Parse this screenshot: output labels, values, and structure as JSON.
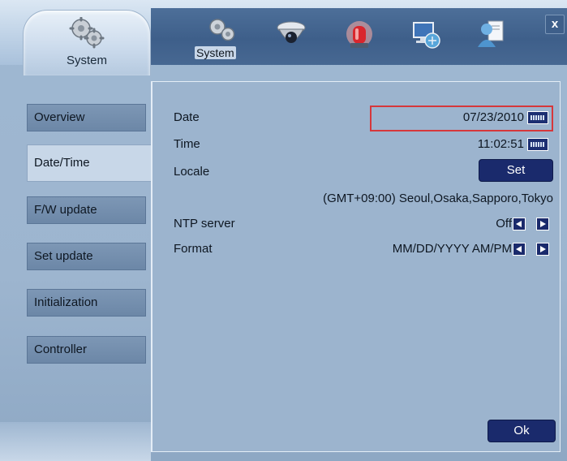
{
  "header": {
    "active_tab_label": "System",
    "icon_row_label": "System",
    "close_label": "x",
    "top_icons": [
      "gear-icon",
      "camera-icon",
      "alarm-icon",
      "network-icon",
      "user-icon"
    ]
  },
  "sidebar": {
    "items": [
      {
        "label": "Overview",
        "active": false
      },
      {
        "label": "Date/Time",
        "active": true
      },
      {
        "label": "F/W update",
        "active": false
      },
      {
        "label": "Set update",
        "active": false
      },
      {
        "label": "Initialization",
        "active": false
      },
      {
        "label": "Controller",
        "active": false
      }
    ]
  },
  "form": {
    "date_label": "Date",
    "date_value": "07/23/2010",
    "time_label": "Time",
    "time_value": "11:02:51",
    "locale_label": "Locale",
    "locale_button": "Set",
    "timezone_value": "(GMT+09:00) Seoul,Osaka,Sapporo,Tokyo",
    "ntp_label": "NTP server",
    "ntp_value": "Off",
    "format_label": "Format",
    "format_value": "MM/DD/YYYY AM/PM",
    "ok_button": "Ok"
  },
  "colors": {
    "accent_dark": "#1a2a6c",
    "highlight_border": "#d6373b",
    "panel_bg": "#9cb4ce",
    "header_dark": "#3e5f8a"
  }
}
